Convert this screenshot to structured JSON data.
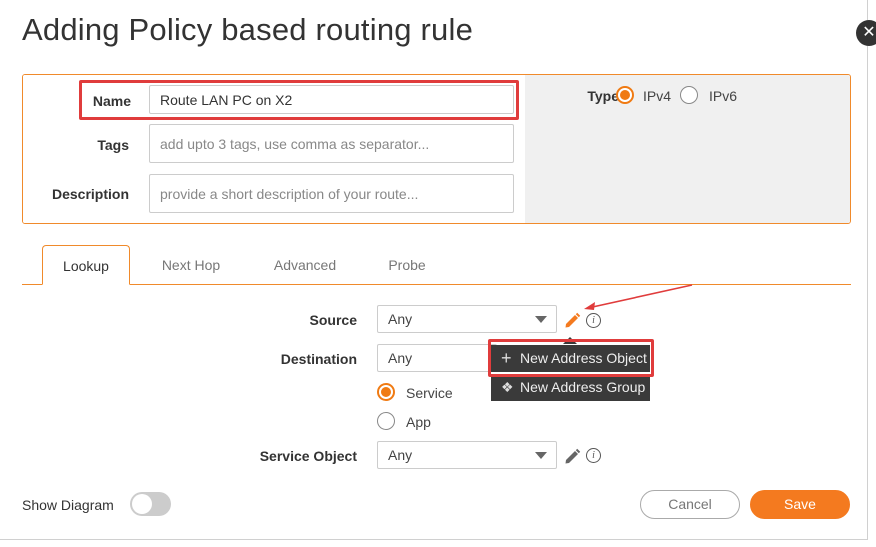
{
  "dialog": {
    "title": "Adding Policy based routing rule",
    "close_glyph": "✕"
  },
  "form": {
    "name": {
      "label": "Name",
      "value": "Route LAN PC on X2"
    },
    "tags": {
      "label": "Tags",
      "placeholder": "add upto 3 tags, use comma as separator..."
    },
    "description": {
      "label": "Description",
      "placeholder": "provide a short description of your route..."
    },
    "type": {
      "label": "Type",
      "options": [
        {
          "label": "IPv4",
          "selected": true
        },
        {
          "label": "IPv6",
          "selected": false
        }
      ]
    }
  },
  "tabs": [
    {
      "label": "Lookup",
      "active": true
    },
    {
      "label": "Next Hop",
      "active": false
    },
    {
      "label": "Advanced",
      "active": false
    },
    {
      "label": "Probe",
      "active": false
    }
  ],
  "lookup": {
    "source": {
      "label": "Source",
      "value": "Any"
    },
    "destination": {
      "label": "Destination",
      "value": "Any"
    },
    "mode_options": [
      {
        "label": "Service",
        "selected": true
      },
      {
        "label": "App",
        "selected": false
      }
    ],
    "service_object": {
      "label": "Service Object",
      "value": "Any"
    }
  },
  "dropdown_menu": {
    "items": [
      {
        "label": "New Address Object",
        "icon": "plus-icon",
        "glyph": "+"
      },
      {
        "label": "New Address Group",
        "icon": "group-add-icon",
        "glyph": "❖"
      }
    ]
  },
  "footer": {
    "show_diagram_label": "Show Diagram",
    "show_diagram_on": false,
    "cancel_label": "Cancel",
    "save_label": "Save"
  },
  "colors": {
    "accent": "#f47a1f",
    "highlight_red": "#e03c3c",
    "menu_bg": "#3a3a3a"
  },
  "info_glyph": "i"
}
